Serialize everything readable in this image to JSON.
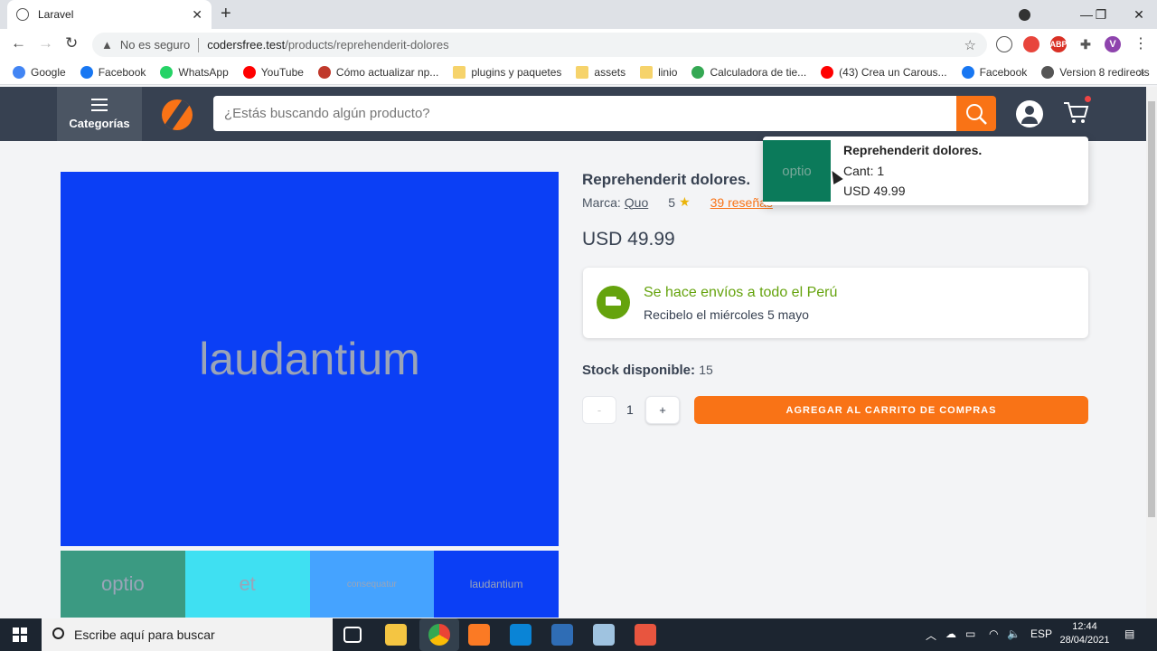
{
  "browser": {
    "tab_title": "Laravel",
    "new_tab": "+",
    "security_label": "No es seguro",
    "url_host": "codersfree.test",
    "url_path": "/products/reprehenderit-dolores",
    "bookmarks": [
      {
        "label": "Google",
        "color": "#4285f4"
      },
      {
        "label": "Facebook",
        "color": "#1877f2"
      },
      {
        "label": "WhatsApp",
        "color": "#25d366"
      },
      {
        "label": "YouTube",
        "color": "#ff0000"
      },
      {
        "label": "Cómo actualizar np...",
        "color": "#c0392b"
      },
      {
        "label": "plugins y paquetes",
        "color": "folder"
      },
      {
        "label": "assets",
        "color": "folder"
      },
      {
        "label": "linio",
        "color": "folder"
      },
      {
        "label": "Calculadora de tie...",
        "color": "#34a853"
      },
      {
        "label": "(43) Crea un Carous...",
        "color": "#ff0000"
      },
      {
        "label": "Facebook",
        "color": "#1877f2"
      },
      {
        "label": "Version 8 redirects",
        "color": "#555555"
      }
    ],
    "bookmarks_more": "»",
    "profile_initial": "V"
  },
  "header": {
    "categories_label": "Categorías",
    "search_placeholder": "¿Estás buscando algún producto?",
    "accent_color": "#f97316"
  },
  "product": {
    "title": "Reprehenderit dolores.",
    "brand_label": "Marca:",
    "brand_value": "Quo",
    "rating": "5",
    "reviews": "39 reseñas",
    "price": "USD 49.99",
    "main_image_text": "laudantium",
    "thumbnails": [
      {
        "text": "optio",
        "color": "#3b9a82"
      },
      {
        "text": "et",
        "color": "#3fe0f2"
      },
      {
        "text": "consequatur",
        "color": "#45a3ff"
      },
      {
        "text": "laudantium",
        "color": "#0b3ff5"
      }
    ],
    "shipping_title": "Se hace envíos a todo el Perú",
    "shipping_subtitle": "Recibelo el miércoles 5 mayo",
    "stock_label": "Stock disponible:",
    "stock_value": "15",
    "qty_minus": "-",
    "qty_value": "1",
    "qty_plus": "+",
    "add_to_cart": "AGREGAR AL CARRITO DE COMPRAS"
  },
  "cart_dropdown": {
    "image_text": "optio",
    "name": "Reprehenderit dolores.",
    "qty": "Cant: 1",
    "price": "USD 49.99"
  },
  "taskbar": {
    "search_placeholder": "Escribe aquí para buscar",
    "language": "ESP",
    "time": "12:44",
    "date": "28/04/2021"
  }
}
